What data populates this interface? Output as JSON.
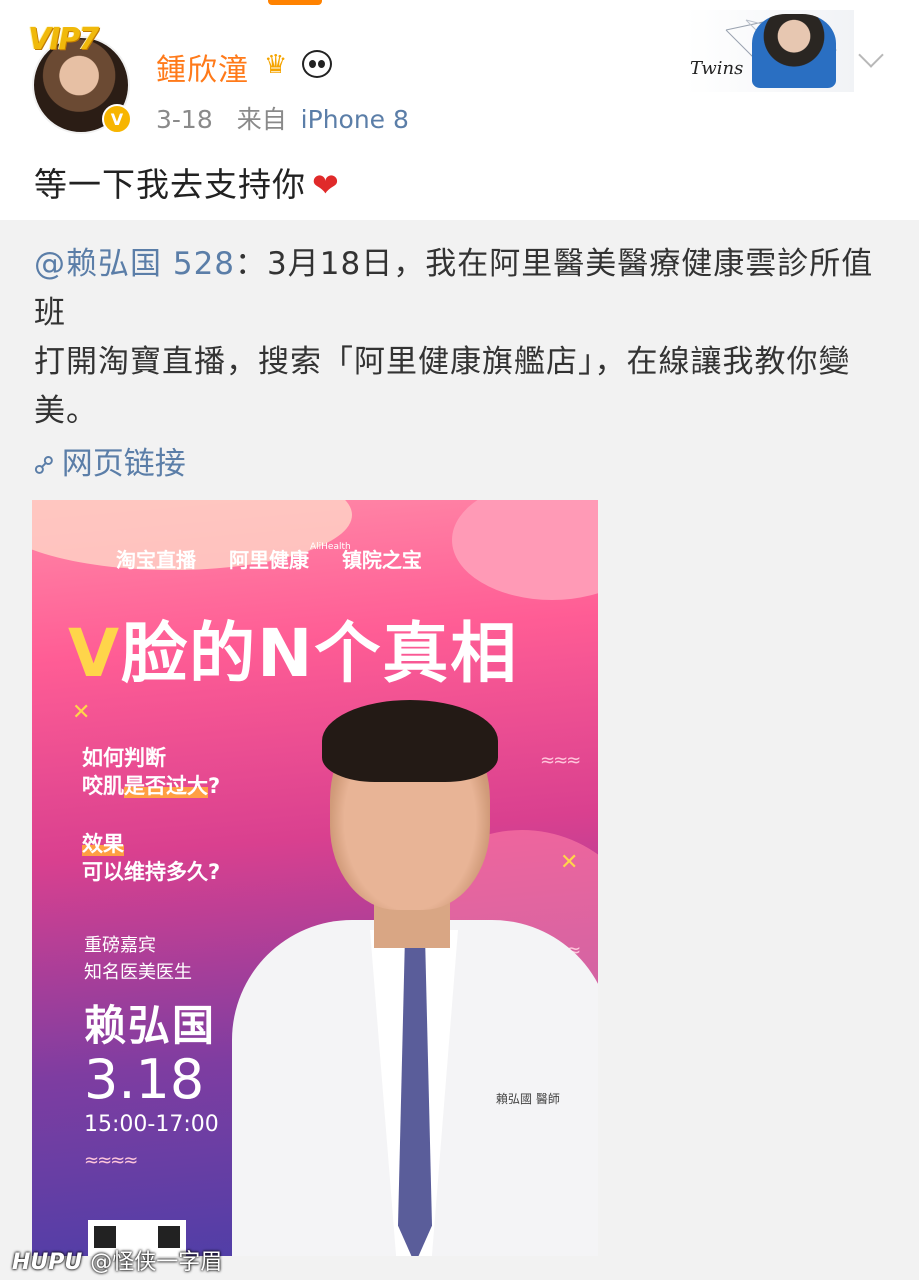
{
  "user": {
    "vip_badge": "VIP7",
    "name": "鍾欣潼",
    "verified_mark": "V",
    "date": "3-18",
    "from_prefix": "来自",
    "source": "iPhone 8"
  },
  "header_card": {
    "signature": "Twins"
  },
  "post": {
    "text": "等一下我去支持你",
    "emoji": "❤"
  },
  "repost": {
    "mention": "@赖弘国 528",
    "line1": "：3月18日，我在阿里醫美醫療健康雲診所值班",
    "line2": "打開淘寶直播，搜索「阿里健康旗艦店」，在線讓我教你變美。",
    "link_label": "网页链接"
  },
  "poster": {
    "brand1": "淘宝直播",
    "brand2_en": "AliHealth",
    "brand2": "阿里健康",
    "brand3": "镇院之宝",
    "title_v": "V",
    "title_rest": "脸的N个真相",
    "q1_line1": "如何判断",
    "q1_line2_pre": "咬肌",
    "q1_line2_hl": "是否过大",
    "q1_line2_post": "?",
    "q2_line1": "效果",
    "q2_line2": "可以维持多久?",
    "guest_line1": "重磅嘉宾",
    "guest_line2": "知名医美医生",
    "doctor_name": "赖弘国",
    "date": "3.18",
    "time": "15:00-17:00",
    "coat_label": "賴弘國 醫師"
  },
  "watermark": {
    "site": "HUPU",
    "author": "@怪侠一字眉"
  },
  "colors": {
    "username": "#ff7a1a",
    "link": "#5b7ea8",
    "heart": "#e02a2a"
  }
}
